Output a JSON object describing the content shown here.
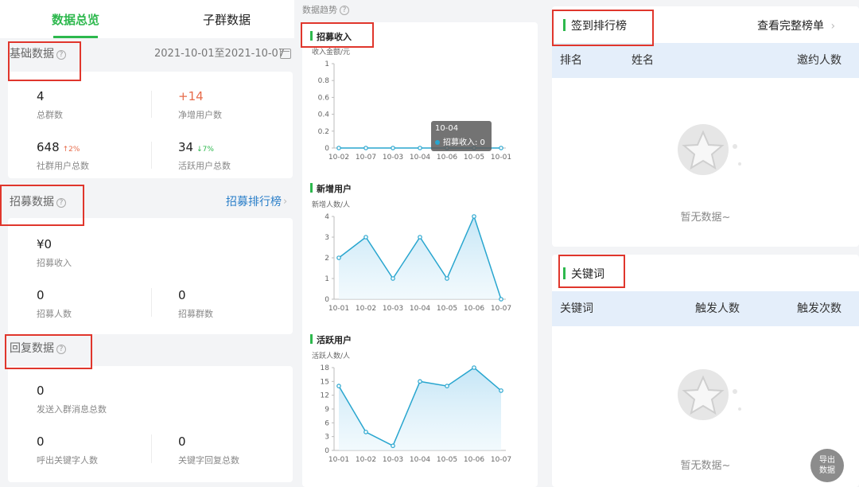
{
  "tabs": [
    {
      "label": "数据总览"
    },
    {
      "label": "子群数据"
    }
  ],
  "basic": {
    "title": "基础数据",
    "help": "?",
    "date_range": "2021-10-01至2021-10-07",
    "stats": [
      {
        "value": "4",
        "label": "总群数"
      },
      {
        "value": "+14",
        "label": "净增用户数"
      },
      {
        "value": "648",
        "delta": "↑2%",
        "label": "社群用户总数"
      },
      {
        "value": "34",
        "delta": "↓7%",
        "label": "活跃用户总数"
      }
    ]
  },
  "recruit": {
    "title": "招募数据",
    "help": "?",
    "link": "招募排行榜",
    "stats": [
      {
        "value": "¥0",
        "label": "招募收入"
      },
      {
        "value": "0",
        "label": "招募人数"
      },
      {
        "value": "0",
        "label": "招募群数"
      }
    ]
  },
  "reply": {
    "title": "回复数据",
    "help": "?",
    "stats": [
      {
        "value": "0",
        "label": "发送入群消息总数"
      },
      {
        "value": "0",
        "label": "呼出关键字人数"
      },
      {
        "value": "0",
        "label": "关键字回复总数"
      }
    ]
  },
  "trend": {
    "header": "数据趋势",
    "tooltip": {
      "date": "10-04",
      "text": "招募收入: 0"
    }
  },
  "chart_data": [
    {
      "type": "line",
      "title": "招募收入",
      "ylabel": "收入金额/元",
      "x": [
        "10-02",
        "10-07",
        "10-03",
        "10-04",
        "10-06",
        "10-05",
        "10-01"
      ],
      "values": [
        0,
        0,
        0,
        0,
        0,
        0,
        0
      ],
      "ylim": [
        0,
        1
      ],
      "yticks": [
        0,
        0.2,
        0.4,
        0.6,
        0.8,
        1
      ],
      "color": "#29a6cf"
    },
    {
      "type": "area",
      "title": "新增用户",
      "ylabel": "新增人数/人",
      "x": [
        "10-01",
        "10-02",
        "10-03",
        "10-04",
        "10-05",
        "10-06",
        "10-07"
      ],
      "values": [
        2,
        3,
        1,
        3,
        1,
        4,
        0
      ],
      "ylim": [
        0,
        4
      ],
      "yticks": [
        0,
        1,
        2,
        3,
        4
      ],
      "color": "#29a6cf"
    },
    {
      "type": "area",
      "title": "活跃用户",
      "ylabel": "活跃人数/人",
      "x": [
        "10-01",
        "10-02",
        "10-03",
        "10-04",
        "10-05",
        "10-06",
        "10-07"
      ],
      "values": [
        14,
        4,
        1,
        15,
        14,
        18,
        13
      ],
      "ylim": [
        0,
        18
      ],
      "yticks": [
        0,
        3,
        6,
        9,
        12,
        15,
        18
      ],
      "color": "#29a6cf"
    }
  ],
  "signin": {
    "title": "签到排行榜",
    "link": "查看完整榜单",
    "columns": [
      "排名",
      "姓名",
      "邀约人数"
    ],
    "empty": "暂无数据~"
  },
  "keywords": {
    "title": "关键词",
    "columns": [
      "关键词",
      "触发人数",
      "触发次数"
    ],
    "empty": "暂无数据~"
  },
  "export": {
    "line1": "导出",
    "line2": "数据"
  },
  "colors": {
    "accent": "#2db84d",
    "link": "#2b7fc9",
    "up": "#e76b4a",
    "annotation": "#e0362c"
  }
}
